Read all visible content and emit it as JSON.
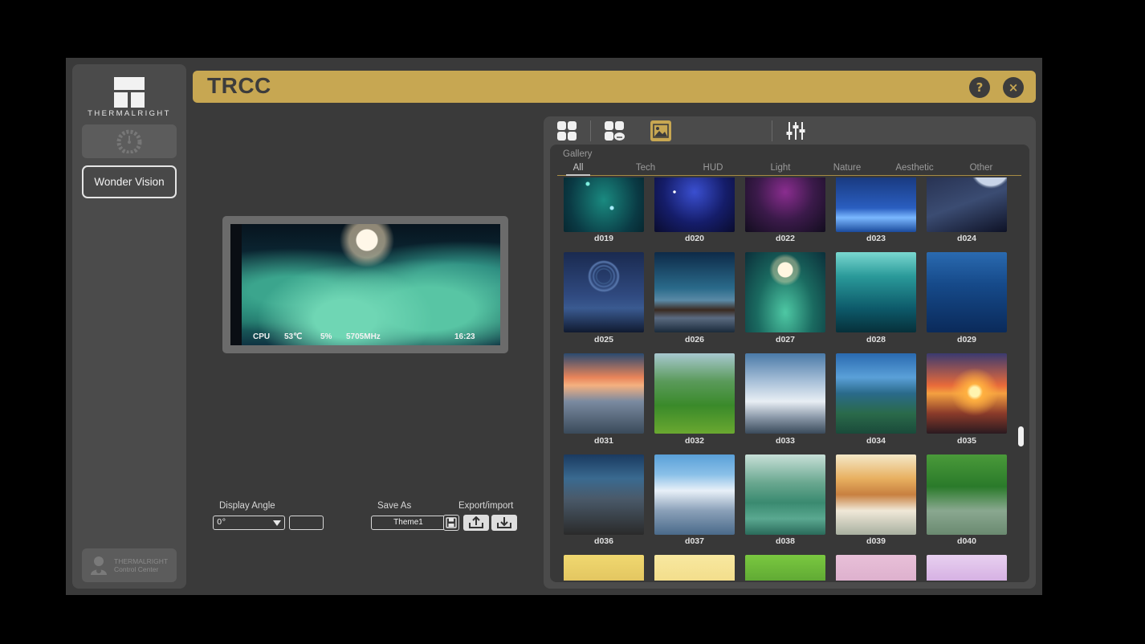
{
  "app": {
    "title": "TRCC",
    "logo_text": "THERMALRIGHT",
    "user_label_line1": "THERMALRIGHT",
    "user_label_line2": "Control Center"
  },
  "sidebar": {
    "items": [
      {
        "label": "",
        "icon": "gauge-icon"
      },
      {
        "label": "Wonder Vision",
        "icon": ""
      }
    ]
  },
  "titlebar": {
    "help_icon": "?",
    "close_icon": "×"
  },
  "preview": {
    "stats": {
      "label": "CPU",
      "temp": "53℃",
      "usage": "5%",
      "freq": "5705MHz",
      "time": "16:23"
    }
  },
  "controls": {
    "display_angle_label": "Display Angle",
    "display_angle_value": "0°",
    "save_as_label": "Save As",
    "export_import_label": "Export/import",
    "theme_name": "Theme1"
  },
  "gallery": {
    "title": "Gallery",
    "tabs": [
      "All",
      "Tech",
      "HUD",
      "Light",
      "Nature",
      "Aesthetic",
      "Other"
    ],
    "active_tab": "All",
    "rows": [
      [
        "d019",
        "d020",
        "d022",
        "d023",
        "d024"
      ],
      [
        "d025",
        "d026",
        "d027",
        "d028",
        "d029"
      ],
      [
        "d031",
        "d032",
        "d033",
        "d034",
        "d035"
      ],
      [
        "d036",
        "d037",
        "d038",
        "d039",
        "d040"
      ],
      [
        "",
        "",
        "",
        "",
        ""
      ]
    ]
  },
  "colors": {
    "accent": "#c7a752",
    "window_bg": "#3a3a3a",
    "panel_bg": "#4b4b4b"
  }
}
